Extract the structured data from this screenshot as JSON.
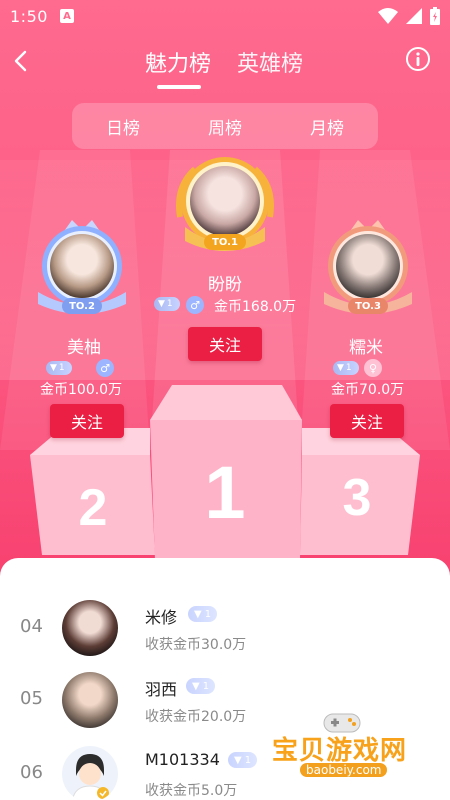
{
  "status_bar": {
    "time": "1:50",
    "app_badge": "A"
  },
  "header": {
    "tabs": [
      {
        "label": "魅力榜",
        "active": true
      },
      {
        "label": "英雄榜",
        "active": false
      }
    ]
  },
  "periods": [
    "日榜",
    "周榜",
    "月榜"
  ],
  "podium": {
    "first": {
      "name": "盼盼",
      "rank_tag": "TO.1",
      "level": "1",
      "gender": "male",
      "coins": "金币168.0万",
      "follow": "关注"
    },
    "second": {
      "name": "美柚",
      "rank_tag": "TO.2",
      "level": "1",
      "gender": "male",
      "coins": "金币100.0万",
      "follow": "关注"
    },
    "third": {
      "name": "糯米",
      "rank_tag": "TO.3",
      "level": "1",
      "gender": "female",
      "coins": "金币70.0万",
      "follow": "关注"
    }
  },
  "list": [
    {
      "rank": "04",
      "name": "米修",
      "level": "1",
      "coins": "收获金币30.0万"
    },
    {
      "rank": "05",
      "name": "羽西",
      "level": "1",
      "coins": "收获金币20.0万"
    },
    {
      "rank": "06",
      "name": "M101334",
      "level": "1",
      "coins": "收获金币5.0万"
    }
  ],
  "watermark": {
    "title": "宝贝游戏网",
    "url": "baobeiy.com"
  },
  "colors": {
    "accent": "#ea1f43",
    "background_top": "#ff6a8f",
    "gold": "#f6b23a",
    "silver": "#8fb0ff",
    "bronze": "#f29a7c"
  }
}
